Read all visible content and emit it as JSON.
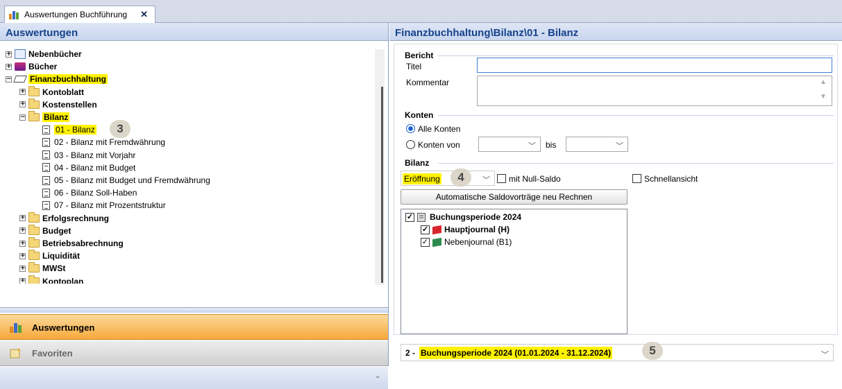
{
  "tab": {
    "title": "Auswertungen Buchführung",
    "close": "✕"
  },
  "left": {
    "header": "Auswertungen",
    "tree": [
      {
        "label": "Nebenbücher",
        "exp": "+"
      },
      {
        "label": "Bücher",
        "exp": "+"
      },
      {
        "label": "Finanzbuchhaltung",
        "exp": "−"
      },
      {
        "label": "Kontoblatt",
        "exp": "+"
      },
      {
        "label": "Kostenstellen",
        "exp": "+"
      },
      {
        "label": "Bilanz",
        "exp": "−"
      },
      {
        "label": "01 - Bilanz"
      },
      {
        "label": "02 - Bilanz mit Fremdwährung"
      },
      {
        "label": "03 - Bilanz mit Vorjahr"
      },
      {
        "label": "04 - Bilanz mit Budget"
      },
      {
        "label": "05 - Bilanz mit Budget und Fremdwährung"
      },
      {
        "label": "06 - Bilanz Soll-Haben"
      },
      {
        "label": "07 - Bilanz mit Prozentstruktur"
      },
      {
        "label": "Erfolgsrechnung",
        "exp": "+"
      },
      {
        "label": "Budget",
        "exp": "+"
      },
      {
        "label": "Betriebsabrechnung",
        "exp": "+"
      },
      {
        "label": "Liquidität",
        "exp": "+"
      },
      {
        "label": "MWSt",
        "exp": "+"
      },
      {
        "label": "Kontoplan",
        "exp": "+"
      }
    ],
    "badge3": "3",
    "splitter_grip": ".....",
    "nav_auswertungen": "Auswertungen",
    "nav_favoriten": "Favoriten"
  },
  "right": {
    "header": "Finanzbuchhaltung\\Bilanz\\01 - Bilanz",
    "bericht": "Bericht",
    "titel_label": "Titel",
    "titel_value": "",
    "kommentar_label": "Kommentar",
    "kommentar_value": "",
    "konten": "Konten",
    "alle_konten": "Alle Konten",
    "konten_von": "Konten von",
    "bis": "bis",
    "bilanz": "Bilanz",
    "eroeffnung": "Eröffnung",
    "badge4": "4",
    "null_saldo": "mit Null-Saldo",
    "schnellansicht": "Schnellansicht",
    "recalc_button": "Automatische Saldovorträge neu Rechnen",
    "period": "Buchungsperiode 2024",
    "hauptjournal": "Hauptjournal (H)",
    "nebenjournal": "Nebenjournal (B1)",
    "footer_prefix": "2 -",
    "footer_period": "Buchungsperiode 2024 (01.01.2024 - 31.12.2024)",
    "badge5": "5"
  },
  "colors": {
    "highlight": "#fff200",
    "header_text": "#15428b",
    "nav_active": "#f6a93b"
  }
}
